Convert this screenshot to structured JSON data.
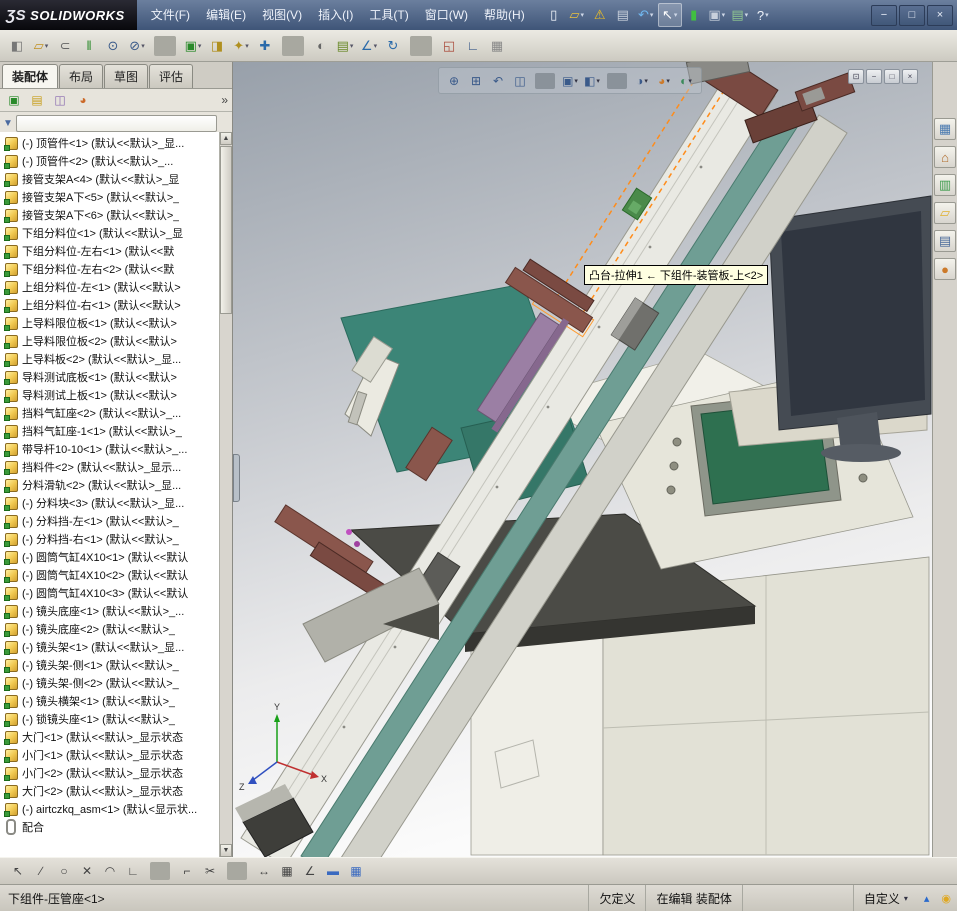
{
  "titlebar": {
    "logo_mark": "ƷS",
    "logo_text": "SOLIDWORKS",
    "menus": [
      "文件(F)",
      "编辑(E)",
      "视图(V)",
      "插入(I)",
      "工具(T)",
      "窗口(W)",
      "帮助(H)"
    ],
    "icons": [
      {
        "name": "new-document-icon",
        "glyph": "▯",
        "color": "#f0f4fa"
      },
      {
        "name": "open-icon",
        "glyph": "▱",
        "color": "#e8c040",
        "dd": true
      },
      {
        "name": "warning-icon",
        "glyph": "⚠",
        "color": "#f0c020"
      },
      {
        "name": "print-icon",
        "glyph": "▤",
        "color": "#c8d0dc"
      },
      {
        "name": "undo-icon",
        "glyph": "↶",
        "color": "#70b8f0",
        "dd": true
      },
      {
        "name": "select-tool-icon",
        "glyph": "↖",
        "color": "#ffffff",
        "dd": true,
        "active": true
      },
      {
        "name": "rebuild-icon",
        "glyph": "▮",
        "color": "#40c040"
      },
      {
        "name": "options-icon",
        "glyph": "▣",
        "color": "#c8d0dc",
        "dd": true
      },
      {
        "name": "appearance-list-icon",
        "glyph": "▤",
        "color": "#90c890",
        "dd": true
      },
      {
        "name": "help-icon",
        "glyph": "?",
        "color": "#f0f4fa",
        "dd": true
      }
    ],
    "window_controls": [
      {
        "name": "minimize-button",
        "glyph": "−"
      },
      {
        "name": "maximize-button",
        "glyph": "□"
      },
      {
        "name": "close-button",
        "glyph": "×"
      }
    ]
  },
  "toolbar2": {
    "icons": [
      {
        "name": "view-settings-icon",
        "glyph": "◧",
        "color": "#777"
      },
      {
        "name": "open-part-icon",
        "glyph": "▱",
        "color": "#c09020",
        "dd": true
      },
      {
        "name": "attach-icon",
        "glyph": "⊂",
        "color": "#666"
      },
      {
        "name": "component-pattern-icon",
        "glyph": "‖",
        "color": "#2a8a2a"
      },
      {
        "name": "find-component-icon",
        "glyph": "⊙",
        "color": "#3a5a8a"
      },
      {
        "name": "zoom-icon",
        "glyph": "⊘",
        "color": "#3a5a8a",
        "dd": true
      },
      {
        "sep": true
      },
      {
        "name": "insert-component-icon",
        "glyph": "▣",
        "color": "#2a8a2a",
        "dd": true
      },
      {
        "name": "mate-icon",
        "glyph": "◨",
        "color": "#b09020"
      },
      {
        "name": "smart-fastener-icon",
        "glyph": "✦",
        "color": "#b09020",
        "dd": true
      },
      {
        "name": "move-component-icon",
        "glyph": "✚",
        "color": "#2a6aaa"
      },
      {
        "sep": true
      },
      {
        "name": "show-hidden-icon",
        "glyph": "◐",
        "color": "#666"
      },
      {
        "name": "assembly-features-icon",
        "glyph": "▤",
        "color": "#6a8a2a",
        "dd": true
      },
      {
        "name": "reference-geometry-icon",
        "glyph": "∠",
        "color": "#2a6aaa",
        "dd": true
      },
      {
        "name": "simulate-icon",
        "glyph": "↻",
        "color": "#2a6aaa"
      },
      {
        "sep": true
      },
      {
        "name": "interference-detection-icon",
        "glyph": "◱",
        "color": "#aa4a3a"
      },
      {
        "name": "measure-icon",
        "glyph": "∟",
        "color": "#3a5a8a"
      },
      {
        "name": "mass-properties-icon",
        "glyph": "▦",
        "color": "#888"
      }
    ]
  },
  "left_panel": {
    "tabs": [
      {
        "label": "装配体",
        "active": true
      },
      {
        "label": "布局"
      },
      {
        "label": "草图"
      },
      {
        "label": "评估"
      }
    ],
    "manager_icons": [
      {
        "name": "featuremanager-icon",
        "glyph": "▣",
        "color": "#2a8a2a"
      },
      {
        "name": "propertymanager-icon",
        "glyph": "▤",
        "color": "#c8a020"
      },
      {
        "name": "configurationmanager-icon",
        "glyph": "◫",
        "color": "#8a6ab0"
      },
      {
        "name": "displaymanager-icon",
        "glyph": "◕",
        "color": "#cc6a2a"
      }
    ],
    "chevron": "»",
    "filter_glyph": "▼",
    "scroll_up": "▲",
    "scroll_down": "▼",
    "tree_items": [
      {
        "label": "(-) 顶管件<1> (默认<<默认>_显...",
        "icon": "part"
      },
      {
        "label": "(-) 顶管件<2> (默认<<默认>_...",
        "icon": "part"
      },
      {
        "label": "接管支架A<4> (默认<<默认>_显",
        "icon": "part"
      },
      {
        "label": "接管支架A下<5> (默认<<默认>_",
        "icon": "part"
      },
      {
        "label": "接管支架A下<6> (默认<<默认>_",
        "icon": "part"
      },
      {
        "label": "下组分料位<1> (默认<<默认>_显",
        "icon": "part"
      },
      {
        "label": "下组分料位-左右<1> (默认<<默",
        "icon": "part"
      },
      {
        "label": "下组分料位-左右<2> (默认<<默",
        "icon": "part"
      },
      {
        "label": "上组分料位-左<1> (默认<<默认>",
        "icon": "part"
      },
      {
        "label": "上组分料位-右<1> (默认<<默认>",
        "icon": "part"
      },
      {
        "label": "上导料限位板<1> (默认<<默认>",
        "icon": "part"
      },
      {
        "label": "上导料限位板<2> (默认<<默认>",
        "icon": "part"
      },
      {
        "label": "上导料板<2> (默认<<默认>_显...",
        "icon": "part"
      },
      {
        "label": "导料测试底板<1> (默认<<默认>",
        "icon": "part"
      },
      {
        "label": "导料测试上板<1> (默认<<默认>",
        "icon": "part"
      },
      {
        "label": "挡料气缸座<2> (默认<<默认>_...",
        "icon": "part"
      },
      {
        "label": "挡料气缸座-1<1> (默认<<默认>_",
        "icon": "part"
      },
      {
        "label": "带导杆10-10<1> (默认<<默认>_...",
        "icon": "part"
      },
      {
        "label": "挡料件<2> (默认<<默认>_显示...",
        "icon": "part"
      },
      {
        "label": "分料滑轨<2> (默认<<默认>_显...",
        "icon": "part"
      },
      {
        "label": "(-) 分料块<3> (默认<<默认>_显...",
        "icon": "part"
      },
      {
        "label": "(-) 分料挡-左<1> (默认<<默认>_",
        "icon": "part"
      },
      {
        "label": "(-) 分料挡-右<1> (默认<<默认>_",
        "icon": "part"
      },
      {
        "label": "(-) 圆筒气缸4X10<1> (默认<<默认",
        "icon": "part"
      },
      {
        "label": "(-) 圆筒气缸4X10<2> (默认<<默认",
        "icon": "part"
      },
      {
        "label": "(-) 圆筒气缸4X10<3> (默认<<默认",
        "icon": "part"
      },
      {
        "label": "(-) 镜头底座<1> (默认<<默认>_...",
        "icon": "part"
      },
      {
        "label": "(-) 镜头底座<2> (默认<<默认>_",
        "icon": "part"
      },
      {
        "label": "(-) 镜头架<1> (默认<<默认>_显...",
        "icon": "part"
      },
      {
        "label": "(-) 镜头架-侧<1> (默认<<默认>_",
        "icon": "part"
      },
      {
        "label": "(-) 镜头架-侧<2> (默认<<默认>_",
        "icon": "part"
      },
      {
        "label": "(-) 镜头横架<1> (默认<<默认>_",
        "icon": "part"
      },
      {
        "label": "(-) 锁镜头座<1> (默认<<默认>_",
        "icon": "part"
      },
      {
        "label": "大门<1> (默认<<默认>_显示状态",
        "icon": "part"
      },
      {
        "label": "小门<1> (默认<<默认>_显示状态",
        "icon": "part"
      },
      {
        "label": "小门<2> (默认<<默认>_显示状态",
        "icon": "part"
      },
      {
        "label": "大门<2> (默认<<默认>_显示状态",
        "icon": "part"
      },
      {
        "label": "(-) airtczkq_asm<1> (默认<显示状...",
        "icon": "part"
      },
      {
        "label": "配合",
        "icon": "mates"
      }
    ]
  },
  "viewport": {
    "hud_icons": [
      {
        "name": "zoom-fit-icon",
        "glyph": "⊕",
        "color": "#3a5a8a"
      },
      {
        "name": "zoom-area-icon",
        "glyph": "⊞",
        "color": "#3a5a8a"
      },
      {
        "name": "previous-view-icon",
        "glyph": "↶",
        "color": "#3a5a8a"
      },
      {
        "name": "section-view-icon",
        "glyph": "◫",
        "color": "#3a5a8a"
      },
      {
        "sep": true
      },
      {
        "name": "view-orientation-icon",
        "glyph": "▣",
        "color": "#3a5a8a",
        "dd": true
      },
      {
        "name": "display-style-icon",
        "glyph": "◧",
        "color": "#3a5a8a",
        "dd": true
      },
      {
        "sep": true
      },
      {
        "name": "hide-show-icon",
        "glyph": "◑",
        "color": "#3a5a8a",
        "dd": true
      },
      {
        "name": "appearance-icon",
        "glyph": "◕",
        "color": "#cc7a2a",
        "dd": true
      },
      {
        "name": "scene-icon",
        "glyph": "◐",
        "color": "#3a8a5a",
        "dd": true
      }
    ],
    "doc_controls": [
      {
        "name": "doc-pin-icon",
        "glyph": "⊡"
      },
      {
        "name": "doc-minimize-icon",
        "glyph": "−"
      },
      {
        "name": "doc-restore-icon",
        "glyph": "□"
      },
      {
        "name": "doc-close-icon",
        "glyph": "×"
      }
    ],
    "tooltip": "凸台-拉伸1 ← 下组件-装管板-上<2>",
    "triad": {
      "x": "X",
      "y": "Y",
      "z": "Z"
    }
  },
  "task_pane": {
    "icons": [
      {
        "name": "resources-icon",
        "glyph": "▦",
        "color": "#4a7ab0"
      },
      {
        "name": "home-icon",
        "glyph": "⌂",
        "color": "#b06a28"
      },
      {
        "name": "design-library-icon",
        "glyph": "▥",
        "color": "#3a9a4a"
      },
      {
        "name": "file-explorer-icon",
        "glyph": "▱",
        "color": "#e0b030"
      },
      {
        "name": "view-palette-icon",
        "glyph": "▤",
        "color": "#4a6a9a"
      },
      {
        "name": "appearances-icon",
        "glyph": "●",
        "color": "#cc7a2a"
      }
    ]
  },
  "sketch_toolbar": {
    "icons": [
      {
        "name": "select-icon",
        "glyph": "↖",
        "color": "#444"
      },
      {
        "name": "line-icon",
        "glyph": "∕",
        "color": "#444"
      },
      {
        "name": "circle-icon",
        "glyph": "○",
        "color": "#444"
      },
      {
        "name": "delete-icon",
        "glyph": "✕",
        "color": "#444"
      },
      {
        "name": "arc-icon",
        "glyph": "◠",
        "color": "#444"
      },
      {
        "name": "perpendicular-icon",
        "glyph": "∟",
        "color": "#444"
      },
      {
        "sep": true
      },
      {
        "name": "corner-rectangle-icon",
        "glyph": "⌐",
        "color": "#444"
      },
      {
        "name": "trim-icon",
        "glyph": "✂",
        "color": "#444"
      },
      {
        "sep": true
      },
      {
        "name": "dimension-icon",
        "glyph": "↔",
        "color": "#444"
      },
      {
        "name": "hatch-icon",
        "glyph": "▦",
        "color": "#444"
      },
      {
        "name": "angle-icon",
        "glyph": "∠",
        "color": "#444"
      },
      {
        "name": "plane-icon",
        "glyph": "▬",
        "color": "#3a6ac0"
      },
      {
        "name": "table-icon",
        "glyph": "▦",
        "color": "#3a6ac0"
      }
    ]
  },
  "status_bar": {
    "selection": "下组件-压管座<1>",
    "constraint": "欠定义",
    "editing": "在编辑 装配体",
    "custom": "自定义",
    "custom_dd": "▾",
    "update_glyph": "▴",
    "tips_glyph": "◉"
  }
}
